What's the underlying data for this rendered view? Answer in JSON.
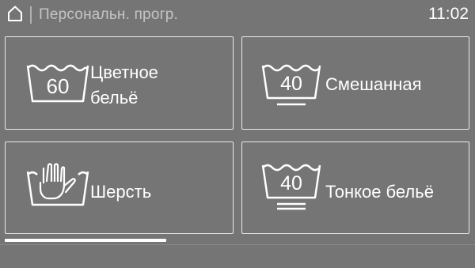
{
  "header": {
    "home_icon": "home-icon",
    "title": "Персональн. прогр.",
    "time": "11:02"
  },
  "programs": [
    {
      "label_line1": "Цветное",
      "label_line2": "бельё",
      "temperature": "60",
      "icon": "wash-60-icon"
    },
    {
      "label": "Смешанная",
      "temperature": "40",
      "icon": "wash-40-permanent-press-icon"
    },
    {
      "label": "Шерсть",
      "icon": "hand-wash-icon"
    },
    {
      "label": "Тонкое бельё",
      "temperature": "40",
      "icon": "wash-40-delicate-icon"
    }
  ],
  "scroll": {
    "position_fraction": 0.34
  },
  "colors": {
    "background": "#757575",
    "foreground": "#ffffff",
    "title": "#c4c4c4"
  }
}
